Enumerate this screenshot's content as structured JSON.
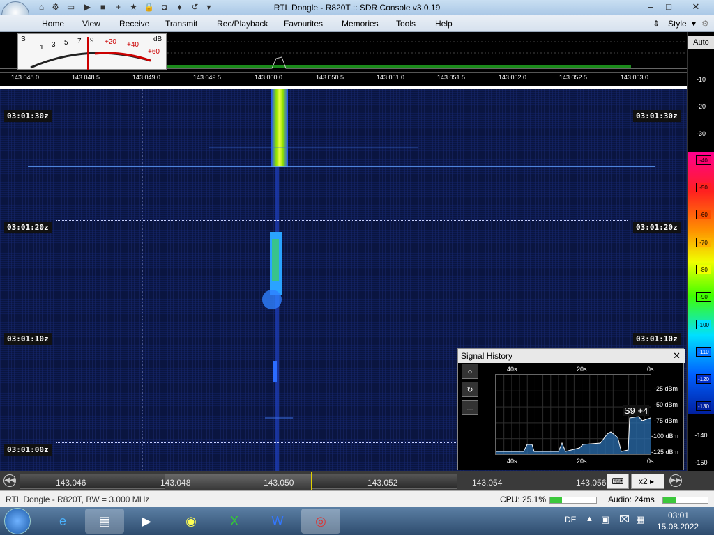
{
  "window": {
    "title": "RTL Dongle - R820T :: SDR Console v3.0.19"
  },
  "menu": {
    "items": [
      "Home",
      "View",
      "Receive",
      "Transmit",
      "Rec/Playback",
      "Favourites",
      "Memories",
      "Tools",
      "Help"
    ],
    "style": "Style"
  },
  "meter": {
    "s_label": "S",
    "db_label": "dB",
    "s_scale": [
      "1",
      "3",
      "5",
      "7",
      "9"
    ],
    "db_scale": [
      "+20",
      "+40",
      "+60"
    ]
  },
  "freq_scale": [
    "143.048.0",
    "143.048.5",
    "143.049.0",
    "143.049.5",
    "143.050.0",
    "143.050.5",
    "143.051.0",
    "143.051.5",
    "143.052.0",
    "143.052.5",
    "143.053.0"
  ],
  "db_scale": {
    "auto": "Auto",
    "labels": [
      "-10",
      "-20",
      "-30",
      "-40",
      "-50",
      "-60",
      "-70",
      "-80",
      "-90",
      "-100",
      "-110",
      "-120",
      "-130",
      "-140",
      "-150"
    ]
  },
  "timestamps": [
    "03:01:30z",
    "03:01:20z",
    "03:01:10z",
    "03:01:00z"
  ],
  "tuner": {
    "freqs": [
      "143.046",
      "143.048",
      "143.050",
      "143.052",
      "143.054",
      "143.056"
    ],
    "zoom": "x2"
  },
  "signal_history": {
    "title": "Signal History",
    "x_top": [
      "40s",
      "20s",
      "0s"
    ],
    "x_bottom": [
      "40s",
      "20s",
      "0s"
    ],
    "y_labels": [
      "-25 dBm",
      "-50 dBm",
      "-75 dBm",
      "-100 dBm",
      "-125 dBm"
    ],
    "reading": "S9 +4",
    "buttons": [
      "○",
      "↻",
      "..."
    ]
  },
  "status": {
    "device": "RTL Dongle - R820T, BW = 3.000 MHz",
    "cpu": "CPU: 25.1%",
    "audio": "Audio: 24ms"
  },
  "taskbar": {
    "lang": "DE",
    "time": "03:01",
    "date": "15.08.2022"
  },
  "colors": {
    "accent": "#2b5797",
    "waterfall_bg": "#0a1540",
    "signal": "#b5e61d"
  }
}
